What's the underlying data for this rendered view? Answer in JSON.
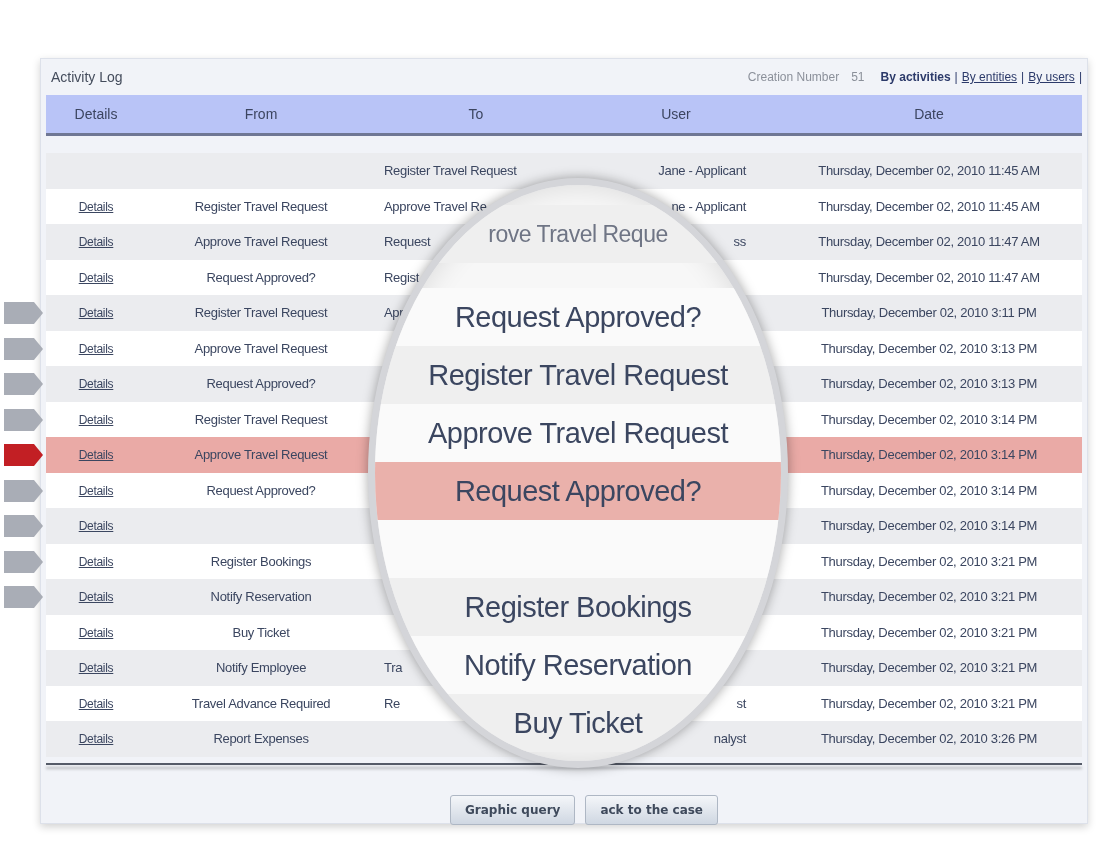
{
  "header": {
    "title": "Activity Log",
    "creation_label": "Creation Number",
    "creation_value": "51",
    "separator": "|",
    "views": [
      {
        "label": "By activities",
        "selected": true
      },
      {
        "label": "By entities",
        "selected": false
      },
      {
        "label": "By users",
        "selected": false
      }
    ]
  },
  "table": {
    "columns": [
      "Details",
      "From",
      "To",
      "User",
      "Date"
    ],
    "rows": [
      {
        "details": "",
        "from": "",
        "to": "Register Travel Request",
        "user": "Jane - Applicant",
        "date": "Thursday, December 02, 2010 11:45 AM",
        "highlighted": false,
        "marker": false
      },
      {
        "details": "Details",
        "from": "Register Travel Request",
        "to": "Approve Travel Re",
        "user": "ne - Applicant",
        "date": "Thursday, December 02, 2010 11:45 AM",
        "highlighted": false,
        "marker": false
      },
      {
        "details": "Details",
        "from": "Approve Travel Request",
        "to": "Request",
        "user": "ss",
        "date": "Thursday, December 02, 2010 11:47 AM",
        "highlighted": false,
        "marker": false
      },
      {
        "details": "Details",
        "from": "Request Approved?",
        "to": "Regist",
        "user": "",
        "date": "Thursday, December 02, 2010 11:47 AM",
        "highlighted": false,
        "marker": false
      },
      {
        "details": "Details",
        "from": "Register Travel Request",
        "to": "Apr",
        "user": "",
        "date": "Thursday, December 02, 2010 3:11 PM",
        "highlighted": false,
        "marker": true
      },
      {
        "details": "Details",
        "from": "Approve Travel Request",
        "to": "",
        "user": "",
        "date": "Thursday, December 02, 2010 3:13 PM",
        "highlighted": false,
        "marker": true
      },
      {
        "details": "Details",
        "from": "Request Approved?",
        "to": "",
        "user": "",
        "date": "Thursday, December 02, 2010 3:13 PM",
        "highlighted": false,
        "marker": true
      },
      {
        "details": "Details",
        "from": "Register Travel Request",
        "to": "",
        "user": "",
        "date": "Thursday, December 02, 2010 3:14 PM",
        "highlighted": false,
        "marker": true
      },
      {
        "details": "Details",
        "from": "Approve Travel Request",
        "to": "",
        "user": "",
        "date": "Thursday, December 02, 2010 3:14 PM",
        "highlighted": true,
        "marker": true
      },
      {
        "details": "Details",
        "from": "Request Approved?",
        "to": "",
        "user": "",
        "date": "Thursday, December 02, 2010 3:14 PM",
        "highlighted": false,
        "marker": true
      },
      {
        "details": "Details",
        "from": "",
        "to": "",
        "user": "",
        "date": "Thursday, December 02, 2010 3:14 PM",
        "highlighted": false,
        "marker": true
      },
      {
        "details": "Details",
        "from": "Register Bookings",
        "to": "",
        "user": "",
        "date": "Thursday, December 02, 2010 3:21 PM",
        "highlighted": false,
        "marker": true
      },
      {
        "details": "Details",
        "from": "Notify Reservation",
        "to": "",
        "user": "",
        "date": "Thursday, December 02, 2010 3:21 PM",
        "highlighted": false,
        "marker": true
      },
      {
        "details": "Details",
        "from": "Buy Ticket",
        "to": "",
        "user": "",
        "date": "Thursday, December 02, 2010 3:21 PM",
        "highlighted": false,
        "marker": false
      },
      {
        "details": "Details",
        "from": "Notify Employee",
        "to": "Tra",
        "user": "",
        "date": "Thursday, December 02, 2010 3:21 PM",
        "highlighted": false,
        "marker": false
      },
      {
        "details": "Details",
        "from": "Travel Advance Required",
        "to": "Re",
        "user": "st",
        "date": "Thursday, December 02, 2010 3:21 PM",
        "highlighted": false,
        "marker": false
      },
      {
        "details": "Details",
        "from": "Report Expenses",
        "to": "",
        "user": "nalyst",
        "date": "Thursday, December 02, 2010 3:26 PM",
        "highlighted": false,
        "marker": false
      }
    ]
  },
  "buttons": [
    "Graphic query",
    "ack to the case"
  ],
  "magnifier": {
    "lines": [
      {
        "kind": "text",
        "text": "rove Travel Reque",
        "highlighted": false
      },
      {
        "kind": "text",
        "text": "Request Approved?",
        "highlighted": false
      },
      {
        "kind": "text",
        "text": "Register Travel Request",
        "highlighted": false
      },
      {
        "kind": "text",
        "text": "Approve Travel Request",
        "highlighted": false
      },
      {
        "kind": "text",
        "text": "Request Approved?",
        "highlighted": true
      },
      {
        "kind": "blank",
        "highlighted": false
      },
      {
        "kind": "text",
        "text": "Register Bookings",
        "highlighted": false
      },
      {
        "kind": "text",
        "text": "Notify Reservation",
        "highlighted": false
      },
      {
        "kind": "text",
        "text": "Buy Ticket",
        "highlighted": false
      }
    ]
  }
}
